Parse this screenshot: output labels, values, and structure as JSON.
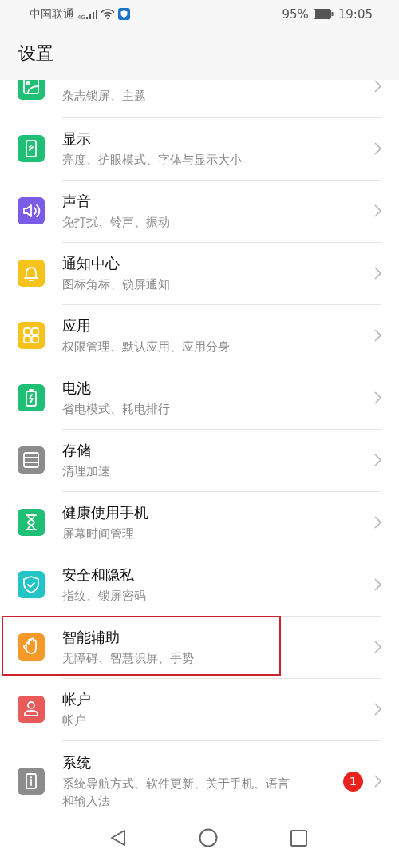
{
  "status_bar": {
    "carrier": "中国联通",
    "network": "4G",
    "battery": "95%",
    "time": "19:05"
  },
  "title": "设置",
  "items": [
    {
      "subtitle": "杂志锁屏、主题",
      "color": "#1fbf76",
      "highlighted": false
    },
    {
      "title": "显示",
      "subtitle": "亮度、护眼模式、字体与显示大小",
      "color": "#1fbf76",
      "highlighted": false
    },
    {
      "title": "声音",
      "subtitle": "免打扰、铃声、振动",
      "color": "#7b5ce6",
      "highlighted": false
    },
    {
      "title": "通知中心",
      "subtitle": "图标角标、锁屏通知",
      "color": "#f6c21c",
      "highlighted": false
    },
    {
      "title": "应用",
      "subtitle": "权限管理、默认应用、应用分身",
      "color": "#f6c21c",
      "highlighted": false
    },
    {
      "title": "电池",
      "subtitle": "省电模式、耗电排行",
      "color": "#1fbf76",
      "highlighted": false
    },
    {
      "title": "存储",
      "subtitle": "清理加速",
      "color": "#8c8c8c",
      "highlighted": false
    },
    {
      "title": "健康使用手机",
      "subtitle": "屏幕时间管理",
      "color": "#1fbf76",
      "highlighted": false
    },
    {
      "title": "安全和隐私",
      "subtitle": "指纹、锁屏密码",
      "color": "#22c4c6",
      "highlighted": false
    },
    {
      "title": "智能辅助",
      "subtitle": "无障碍、智慧识屏、手势",
      "color": "#f59a2a",
      "highlighted": true
    },
    {
      "title": "帐户",
      "subtitle": "帐户",
      "color": "#e95b5b",
      "highlighted": false
    },
    {
      "title": "系统",
      "subtitle": "系统导航方式、软件更新、关于手机、语言和输入法",
      "color": "#8c8c8c",
      "highlighted": false,
      "badge": "1"
    }
  ]
}
